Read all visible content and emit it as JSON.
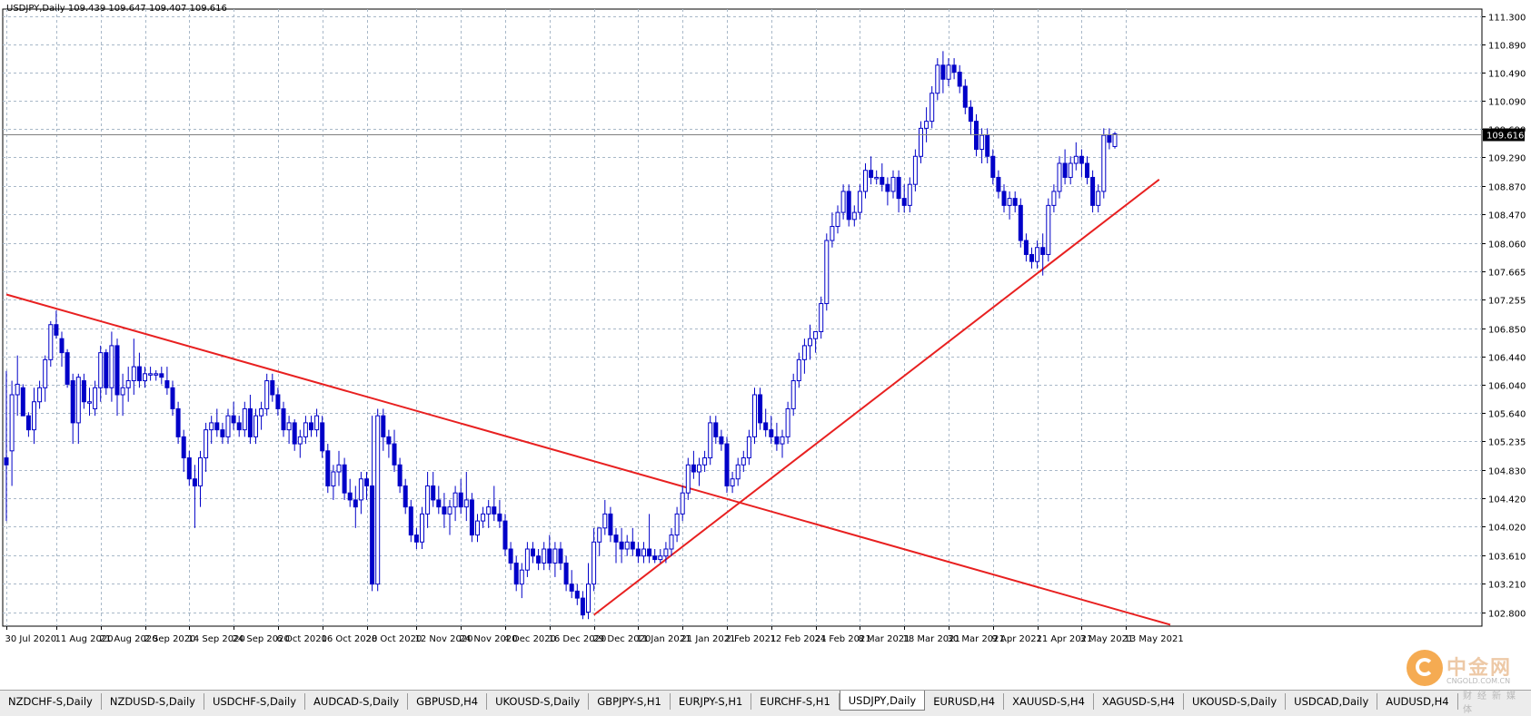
{
  "title": "USDJPY,Daily  109.439 109.647 109.407 109.616",
  "current_price_label": "109.616",
  "colors": {
    "background": "#ffffff",
    "grid": "#a8b8c8",
    "candle": "#0000c8",
    "trendline": "#e82020",
    "price_line": "#808080"
  },
  "tabs": [
    {
      "label": "NZDCHF-S,Daily",
      "active": false
    },
    {
      "label": "NZDUSD-S,Daily",
      "active": false
    },
    {
      "label": "USDCHF-S,Daily",
      "active": false
    },
    {
      "label": "AUDCAD-S,Daily",
      "active": false
    },
    {
      "label": "GBPUSD,H4",
      "active": false
    },
    {
      "label": "UKOUSD-S,Daily",
      "active": false
    },
    {
      "label": "GBPJPY-S,H1",
      "active": false
    },
    {
      "label": "EURJPY-S,H1",
      "active": false
    },
    {
      "label": "EURCHF-S,H1",
      "active": false
    },
    {
      "label": "USDJPY,Daily",
      "active": true
    },
    {
      "label": "EURUSD,H4",
      "active": false
    },
    {
      "label": "XAUUSD-S,H4",
      "active": false
    },
    {
      "label": "XAGUSD-S,H4",
      "active": false
    },
    {
      "label": "UKOUSD-S,Daily",
      "active": false
    },
    {
      "label": "USDCAD,Daily",
      "active": false
    },
    {
      "label": "AUDUSD,H4",
      "active": false
    }
  ],
  "watermark": {
    "name": "中金网",
    "url": "CNGOLD.COM.CN",
    "sub": "财经新媒体"
  },
  "chart_data": {
    "type": "candlestick",
    "symbol": "USDJPY",
    "timeframe": "Daily",
    "ohlc_header": {
      "open": 109.439,
      "high": 109.647,
      "low": 109.407,
      "close": 109.616
    },
    "ylim": [
      102.6,
      111.4
    ],
    "y_ticks": [
      "111.300",
      "110.890",
      "110.490",
      "110.090",
      "109.690",
      "109.290",
      "108.870",
      "108.470",
      "108.060",
      "107.665",
      "107.255",
      "106.850",
      "106.440",
      "106.040",
      "105.640",
      "105.235",
      "104.830",
      "104.420",
      "104.020",
      "103.610",
      "103.210",
      "102.800"
    ],
    "x_tick_labels": [
      "30 Jul 2020",
      "11 Aug 2020",
      "21 Aug 2020",
      "2 Sep 2020",
      "14 Sep 2020",
      "24 Sep 2020",
      "6 Oct 2020",
      "16 Oct 2020",
      "28 Oct 2020",
      "12 Nov 2020",
      "24 Nov 2020",
      "4 Dec 2020",
      "16 Dec 2020",
      "29 Dec 2020",
      "11 Jan 2021",
      "21 Jan 2021",
      "2 Feb 2021",
      "12 Feb 2021",
      "24 Feb 2021",
      "8 Mar 2021",
      "18 Mar 2021",
      "30 Mar 2021",
      "9 Apr 2021",
      "21 Apr 2021",
      "3 May 2021",
      "13 May 2021"
    ],
    "x_tick_index": [
      0,
      9,
      17,
      25,
      33,
      41,
      49,
      57,
      65,
      74,
      82,
      90,
      98,
      106,
      114,
      122,
      130,
      138,
      146,
      154,
      162,
      170,
      178,
      186,
      194,
      202
    ],
    "current_price": 109.616,
    "trendlines": [
      {
        "name": "",
        "from": [
          0,
          107.33
        ],
        "to": [
          210,
          102.62
        ]
      },
      {
        "name": "",
        "from": [
          106,
          102.76
        ],
        "to": [
          208,
          108.97
        ]
      }
    ],
    "candles": [
      [
        105.0,
        106.24,
        104.1,
        104.9
      ],
      [
        105.1,
        106.1,
        104.6,
        105.9
      ],
      [
        105.9,
        106.46,
        105.6,
        106.05
      ],
      [
        106.0,
        106.05,
        105.6,
        105.6
      ],
      [
        105.6,
        105.65,
        105.3,
        105.4
      ],
      [
        105.4,
        106.0,
        105.2,
        105.8
      ],
      [
        105.8,
        106.1,
        105.7,
        106.0
      ],
      [
        106.0,
        106.46,
        105.8,
        106.4
      ],
      [
        106.4,
        106.95,
        106.3,
        106.9
      ],
      [
        106.9,
        107.1,
        106.7,
        106.75
      ],
      [
        106.7,
        106.8,
        106.3,
        106.5
      ],
      [
        106.5,
        106.55,
        106.0,
        106.05
      ],
      [
        106.1,
        106.2,
        105.2,
        105.5
      ],
      [
        105.5,
        106.2,
        105.2,
        106.15
      ],
      [
        106.1,
        106.2,
        105.7,
        105.8
      ],
      [
        105.8,
        106.0,
        105.6,
        105.8
      ],
      [
        105.7,
        106.1,
        105.6,
        106.0
      ],
      [
        106.0,
        106.6,
        105.8,
        106.5
      ],
      [
        106.5,
        106.55,
        105.9,
        106.0
      ],
      [
        106.0,
        106.8,
        105.8,
        106.6
      ],
      [
        106.6,
        106.7,
        105.6,
        105.9
      ],
      [
        105.9,
        106.2,
        105.6,
        106.0
      ],
      [
        106.0,
        106.3,
        105.8,
        106.1
      ],
      [
        106.1,
        106.7,
        105.9,
        106.3
      ],
      [
        106.3,
        106.5,
        106.0,
        106.1
      ],
      [
        106.1,
        106.3,
        106.0,
        106.2
      ],
      [
        106.2,
        106.3,
        106.1,
        106.2
      ],
      [
        106.2,
        106.25,
        106.1,
        106.2
      ],
      [
        106.2,
        106.3,
        106.05,
        106.15
      ],
      [
        106.1,
        106.3,
        105.9,
        106.0
      ],
      [
        106.0,
        106.1,
        105.6,
        105.7
      ],
      [
        105.7,
        105.8,
        105.2,
        105.3
      ],
      [
        105.3,
        105.4,
        104.8,
        105.0
      ],
      [
        105.0,
        105.1,
        104.6,
        104.7
      ],
      [
        104.7,
        104.9,
        104.0,
        104.6
      ],
      [
        104.6,
        105.1,
        104.3,
        105.0
      ],
      [
        105.0,
        105.5,
        104.8,
        105.4
      ],
      [
        105.4,
        105.6,
        105.2,
        105.5
      ],
      [
        105.5,
        105.7,
        105.3,
        105.4
      ],
      [
        105.4,
        105.5,
        105.2,
        105.3
      ],
      [
        105.3,
        105.7,
        105.2,
        105.6
      ],
      [
        105.6,
        105.8,
        105.4,
        105.5
      ],
      [
        105.5,
        105.6,
        105.3,
        105.4
      ],
      [
        105.4,
        105.8,
        105.3,
        105.7
      ],
      [
        105.7,
        105.9,
        105.2,
        105.3
      ],
      [
        105.3,
        105.7,
        105.2,
        105.6
      ],
      [
        105.6,
        105.8,
        105.4,
        105.7
      ],
      [
        105.7,
        106.2,
        105.6,
        106.1
      ],
      [
        106.1,
        106.2,
        105.8,
        105.9
      ],
      [
        105.9,
        106.0,
        105.6,
        105.7
      ],
      [
        105.7,
        105.8,
        105.3,
        105.4
      ],
      [
        105.4,
        105.6,
        105.2,
        105.5
      ],
      [
        105.5,
        105.55,
        105.1,
        105.2
      ],
      [
        105.2,
        105.4,
        105.0,
        105.3
      ],
      [
        105.3,
        105.6,
        105.2,
        105.5
      ],
      [
        105.5,
        105.6,
        105.3,
        105.4
      ],
      [
        105.4,
        105.7,
        105.3,
        105.6
      ],
      [
        105.5,
        105.6,
        105.0,
        105.1
      ],
      [
        105.1,
        105.2,
        104.5,
        104.6
      ],
      [
        104.6,
        104.9,
        104.4,
        104.8
      ],
      [
        104.8,
        105.1,
        104.6,
        104.9
      ],
      [
        104.9,
        105.0,
        104.4,
        104.5
      ],
      [
        104.5,
        104.7,
        104.3,
        104.4
      ],
      [
        104.4,
        104.6,
        104.0,
        104.3
      ],
      [
        104.4,
        104.8,
        104.2,
        104.7
      ],
      [
        104.7,
        104.8,
        104.4,
        104.6
      ],
      [
        104.6,
        105.6,
        103.1,
        103.2
      ],
      [
        103.2,
        105.7,
        103.1,
        105.6
      ],
      [
        105.6,
        105.7,
        105.1,
        105.3
      ],
      [
        105.3,
        105.4,
        105.0,
        105.2
      ],
      [
        105.2,
        105.4,
        104.8,
        104.9
      ],
      [
        104.9,
        105.0,
        104.5,
        104.6
      ],
      [
        104.6,
        104.7,
        104.2,
        104.3
      ],
      [
        104.3,
        104.4,
        103.8,
        103.9
      ],
      [
        103.9,
        104.0,
        103.7,
        103.8
      ],
      [
        103.8,
        104.3,
        103.7,
        104.2
      ],
      [
        104.2,
        104.8,
        104.0,
        104.6
      ],
      [
        104.6,
        104.8,
        104.3,
        104.4
      ],
      [
        104.4,
        104.6,
        104.2,
        104.3
      ],
      [
        104.3,
        104.5,
        104.0,
        104.2
      ],
      [
        104.2,
        104.4,
        103.9,
        104.3
      ],
      [
        104.3,
        104.6,
        104.1,
        104.5
      ],
      [
        104.5,
        104.7,
        104.2,
        104.3
      ],
      [
        104.3,
        104.8,
        104.1,
        104.4
      ],
      [
        104.4,
        104.5,
        103.8,
        103.9
      ],
      [
        103.9,
        104.2,
        103.8,
        104.1
      ],
      [
        104.1,
        104.3,
        104.0,
        104.2
      ],
      [
        104.2,
        104.4,
        104.0,
        104.3
      ],
      [
        104.3,
        104.6,
        104.1,
        104.2
      ],
      [
        104.2,
        104.4,
        104.0,
        104.1
      ],
      [
        104.1,
        104.2,
        103.6,
        103.7
      ],
      [
        103.7,
        103.8,
        103.4,
        103.5
      ],
      [
        103.5,
        103.6,
        103.1,
        103.2
      ],
      [
        103.2,
        103.5,
        103.0,
        103.4
      ],
      [
        103.4,
        103.8,
        103.3,
        103.7
      ],
      [
        103.7,
        103.8,
        103.5,
        103.6
      ],
      [
        103.6,
        103.7,
        103.4,
        103.5
      ],
      [
        103.5,
        103.8,
        103.4,
        103.7
      ],
      [
        103.7,
        103.9,
        103.4,
        103.5
      ],
      [
        103.5,
        103.8,
        103.3,
        103.7
      ],
      [
        103.7,
        103.8,
        103.4,
        103.5
      ],
      [
        103.5,
        103.6,
        103.1,
        103.2
      ],
      [
        103.2,
        103.4,
        103.0,
        103.1
      ],
      [
        103.1,
        103.2,
        102.9,
        103.0
      ],
      [
        103.0,
        103.1,
        102.7,
        102.76
      ],
      [
        102.8,
        103.5,
        102.7,
        103.2
      ],
      [
        103.2,
        104.0,
        103.1,
        103.8
      ],
      [
        103.8,
        104.0,
        103.6,
        104.0
      ],
      [
        104.0,
        104.4,
        103.9,
        104.2
      ],
      [
        104.2,
        104.3,
        103.8,
        103.9
      ],
      [
        103.9,
        104.0,
        103.5,
        103.8
      ],
      [
        103.8,
        104.0,
        103.5,
        103.7
      ],
      [
        103.7,
        103.9,
        103.6,
        103.8
      ],
      [
        103.8,
        104.0,
        103.6,
        103.7
      ],
      [
        103.7,
        103.8,
        103.5,
        103.6
      ],
      [
        103.6,
        103.8,
        103.5,
        103.7
      ],
      [
        103.7,
        104.2,
        103.5,
        103.6
      ],
      [
        103.6,
        103.7,
        103.5,
        103.55
      ],
      [
        103.55,
        103.7,
        103.5,
        103.6
      ],
      [
        103.6,
        103.8,
        103.5,
        103.7
      ],
      [
        103.7,
        104.0,
        103.6,
        103.9
      ],
      [
        103.9,
        104.3,
        103.8,
        104.2
      ],
      [
        104.2,
        104.6,
        104.1,
        104.5
      ],
      [
        104.5,
        105.0,
        104.4,
        104.9
      ],
      [
        104.9,
        105.1,
        104.7,
        104.8
      ],
      [
        104.8,
        105.0,
        104.6,
        104.9
      ],
      [
        104.9,
        105.1,
        104.8,
        105.0
      ],
      [
        105.0,
        105.6,
        104.9,
        105.5
      ],
      [
        105.5,
        105.6,
        105.2,
        105.3
      ],
      [
        105.3,
        105.4,
        105.1,
        105.2
      ],
      [
        105.2,
        105.3,
        104.5,
        104.6
      ],
      [
        104.6,
        104.8,
        104.5,
        104.7
      ],
      [
        104.7,
        105.0,
        104.6,
        104.9
      ],
      [
        104.9,
        105.1,
        104.8,
        105.0
      ],
      [
        105.0,
        105.4,
        104.9,
        105.3
      ],
      [
        105.3,
        106.0,
        105.2,
        105.9
      ],
      [
        105.9,
        106.0,
        105.4,
        105.5
      ],
      [
        105.5,
        105.7,
        105.3,
        105.4
      ],
      [
        105.4,
        105.6,
        105.2,
        105.3
      ],
      [
        105.3,
        105.5,
        105.1,
        105.2
      ],
      [
        105.2,
        105.4,
        105.0,
        105.3
      ],
      [
        105.3,
        105.8,
        105.2,
        105.7
      ],
      [
        105.7,
        106.2,
        105.6,
        106.1
      ],
      [
        106.1,
        106.5,
        106.0,
        106.4
      ],
      [
        106.4,
        106.7,
        106.2,
        106.6
      ],
      [
        106.6,
        106.9,
        106.4,
        106.7
      ],
      [
        106.7,
        106.8,
        106.5,
        106.8
      ],
      [
        106.8,
        107.3,
        106.7,
        107.2
      ],
      [
        107.2,
        108.2,
        107.1,
        108.1
      ],
      [
        108.1,
        108.5,
        108.0,
        108.3
      ],
      [
        108.3,
        108.6,
        108.2,
        108.5
      ],
      [
        108.5,
        108.9,
        108.4,
        108.8
      ],
      [
        108.8,
        108.9,
        108.3,
        108.4
      ],
      [
        108.4,
        108.6,
        108.3,
        108.5
      ],
      [
        108.5,
        108.9,
        108.4,
        108.8
      ],
      [
        108.8,
        109.2,
        108.7,
        109.1
      ],
      [
        109.1,
        109.3,
        108.9,
        109.0
      ],
      [
        109.0,
        109.1,
        108.9,
        109.0
      ],
      [
        109.0,
        109.2,
        108.8,
        108.9
      ],
      [
        108.9,
        109.0,
        108.6,
        108.8
      ],
      [
        108.8,
        109.1,
        108.7,
        109.0
      ],
      [
        109.0,
        109.1,
        108.5,
        108.7
      ],
      [
        108.7,
        108.9,
        108.5,
        108.6
      ],
      [
        108.6,
        109.0,
        108.5,
        108.9
      ],
      [
        108.9,
        109.4,
        108.8,
        109.3
      ],
      [
        109.3,
        109.8,
        109.2,
        109.7
      ],
      [
        109.7,
        110.0,
        109.5,
        109.8
      ],
      [
        109.8,
        110.3,
        109.7,
        110.2
      ],
      [
        110.2,
        110.7,
        110.1,
        110.6
      ],
      [
        110.6,
        110.8,
        110.2,
        110.4
      ],
      [
        110.4,
        110.7,
        110.3,
        110.6
      ],
      [
        110.6,
        110.7,
        110.4,
        110.5
      ],
      [
        110.5,
        110.6,
        110.2,
        110.3
      ],
      [
        110.3,
        110.4,
        109.9,
        110.0
      ],
      [
        110.0,
        110.1,
        109.6,
        109.8
      ],
      [
        109.8,
        109.9,
        109.3,
        109.4
      ],
      [
        109.4,
        109.7,
        109.2,
        109.6
      ],
      [
        109.6,
        109.7,
        109.2,
        109.3
      ],
      [
        109.3,
        109.4,
        108.9,
        109.0
      ],
      [
        109.0,
        109.1,
        108.7,
        108.8
      ],
      [
        108.8,
        108.9,
        108.5,
        108.6
      ],
      [
        108.6,
        108.8,
        108.4,
        108.7
      ],
      [
        108.7,
        108.8,
        108.5,
        108.6
      ],
      [
        108.6,
        108.7,
        108.0,
        108.1
      ],
      [
        108.1,
        108.2,
        107.8,
        107.9
      ],
      [
        107.9,
        108.0,
        107.7,
        107.8
      ],
      [
        107.8,
        108.1,
        107.7,
        108.0
      ],
      [
        108.0,
        108.2,
        107.6,
        107.9
      ],
      [
        107.9,
        108.7,
        107.8,
        108.6
      ],
      [
        108.6,
        108.9,
        108.5,
        108.8
      ],
      [
        108.8,
        109.3,
        108.7,
        109.2
      ],
      [
        109.2,
        109.4,
        108.9,
        109.0
      ],
      [
        109.0,
        109.3,
        108.9,
        109.2
      ],
      [
        109.2,
        109.5,
        109.1,
        109.3
      ],
      [
        109.3,
        109.4,
        109.0,
        109.2
      ],
      [
        109.2,
        109.3,
        108.9,
        109.0
      ],
      [
        109.0,
        109.1,
        108.5,
        108.6
      ],
      [
        108.6,
        108.9,
        108.5,
        108.8
      ],
      [
        108.8,
        109.7,
        108.7,
        109.6
      ],
      [
        109.6,
        109.7,
        109.4,
        109.5
      ],
      [
        109.44,
        109.65,
        109.41,
        109.62
      ]
    ]
  }
}
